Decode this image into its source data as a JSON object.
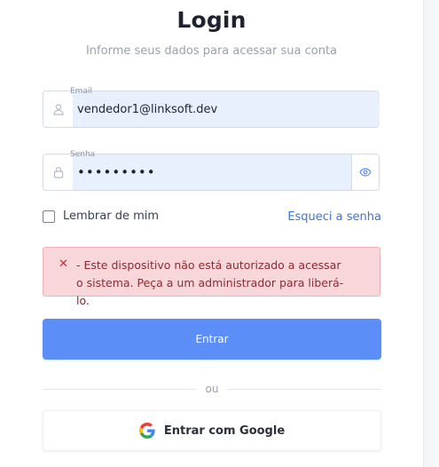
{
  "header": {
    "title": "Login",
    "subtitle": "Informe seus dados para acessar sua conta"
  },
  "email": {
    "label": "Email",
    "value": "vendedor1@linksoft.dev",
    "icon": "user-icon"
  },
  "senha": {
    "label": "Senha",
    "value": "•••••••••",
    "icon": "lock-icon",
    "toggle_icon": "eye-icon"
  },
  "remember": {
    "label": "Lembrar de mim",
    "checked": false
  },
  "forgot": {
    "label": "Esqueci a senha"
  },
  "alert": {
    "icon": "close-icon",
    "message": "- Este dispositivo não está autorizado a acessar o sistema. Peça a um administrador para liberá-lo."
  },
  "submit": {
    "label": "Entrar"
  },
  "divider": {
    "label": "ou"
  },
  "google": {
    "label": "Entrar com Google",
    "icon": "google-icon"
  },
  "colors": {
    "primary": "#5b8ef7",
    "link": "#3b73e0",
    "alert_bg": "#f8d7da",
    "alert_text": "#8a2a33",
    "autofill_bg": "#e8f0fe"
  }
}
